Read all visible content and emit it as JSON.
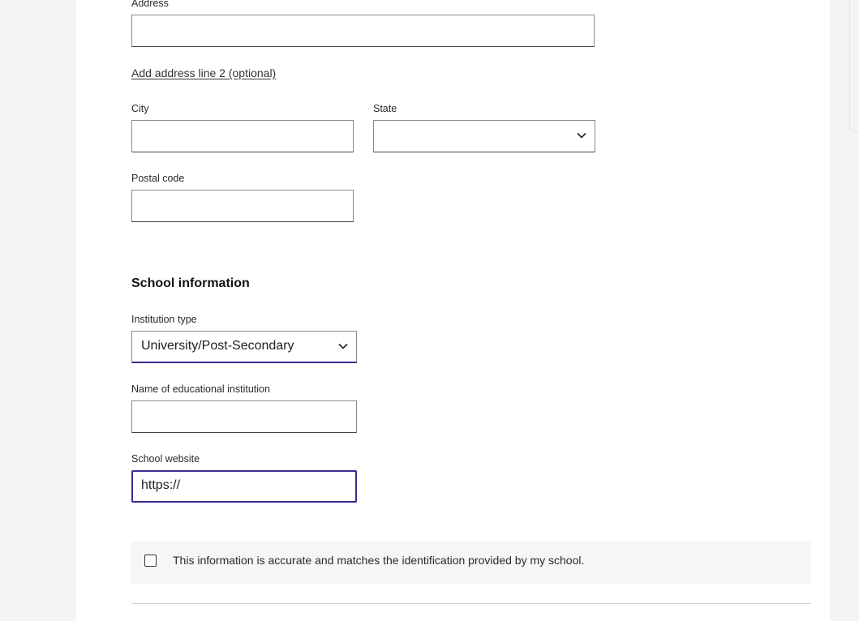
{
  "address": {
    "label": "Address",
    "value": "",
    "add_line2_link": "Add address line 2 (optional)"
  },
  "city": {
    "label": "City",
    "value": ""
  },
  "state": {
    "label": "State",
    "selected": ""
  },
  "postal_code": {
    "label": "Postal code",
    "value": ""
  },
  "school_section": {
    "title": "School information",
    "institution_type": {
      "label": "Institution type",
      "selected": "University/Post-Secondary"
    },
    "institution_name": {
      "label": "Name of educational institution",
      "value": ""
    },
    "school_website": {
      "label": "School website",
      "value": "https://"
    }
  },
  "consent": {
    "checked": false,
    "text": "This information is accurate and matches the identification provided by my school."
  },
  "icons": {
    "select_arrow": "chevron-down-icon",
    "checkbox": "checkbox-icon"
  },
  "colors": {
    "focus_border": "#3b2c8f",
    "page_background": "#f4f4f4",
    "card_background": "#ffffff"
  }
}
